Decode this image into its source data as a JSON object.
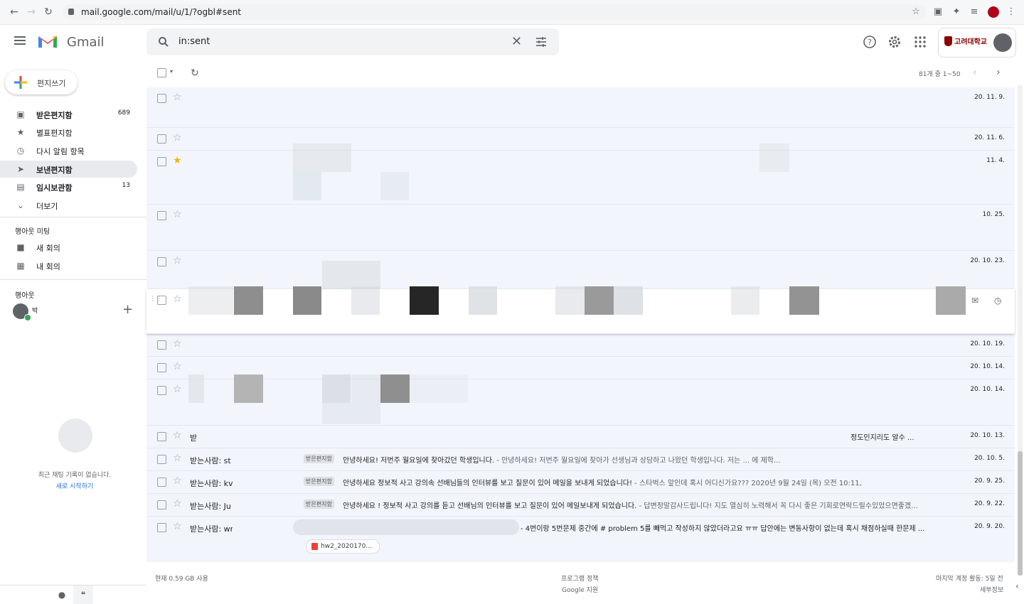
{
  "browser": {
    "url": "mail.google.com/mail/u/1/?ogbl#sent"
  },
  "header": {
    "app_name": "Gmail",
    "search_value": "in:sent",
    "org_logo_text": "고려대학교"
  },
  "sidebar": {
    "compose_label": "편지쓰기",
    "items": [
      {
        "label": "받은편지함",
        "count": "689",
        "icon": "inbox-icon"
      },
      {
        "label": "별표편지함",
        "count": "",
        "icon": "star-icon"
      },
      {
        "label": "다시 알림 항목",
        "count": "",
        "icon": "clock-icon"
      },
      {
        "label": "보낸편지함",
        "count": "",
        "icon": "send-icon"
      },
      {
        "label": "임시보관함",
        "count": "13",
        "icon": "draft-icon"
      },
      {
        "label": "더보기",
        "count": "",
        "icon": "chevron-down-icon"
      }
    ],
    "meet_section": "행아웃 미팅",
    "meet_items": [
      {
        "label": "새 회의",
        "icon": "video-icon"
      },
      {
        "label": "내 회의",
        "icon": "calendar-icon"
      }
    ],
    "hangouts_section": "행아웃",
    "hangouts_user": "박",
    "chat_empty": "최근 채팅 기록이 없습니다.",
    "chat_start": "새로 시작하기"
  },
  "toolbar": {
    "pager_text": "81개 중 1~50"
  },
  "emails": [
    {
      "sender": "",
      "label": "",
      "subject": "",
      "snippet": "",
      "date": "20. 11. 9.",
      "starred": false
    },
    {
      "sender": "",
      "label": "",
      "subject": "",
      "snippet": "",
      "date": "20. 11. 6.",
      "starred": false
    },
    {
      "sender": "",
      "label": "",
      "subject": "",
      "snippet": "",
      "date": "11. 4.",
      "starred": true
    },
    {
      "sender": "",
      "label": "",
      "subject": "",
      "snippet": "",
      "date": "10. 25.",
      "starred": false
    },
    {
      "sender": "",
      "label": "",
      "subject": "",
      "snippet": "",
      "date": "20. 10. 23.",
      "starred": false
    },
    {
      "sender": "",
      "label": "",
      "subject": "",
      "snippet": "",
      "date": "",
      "starred": false
    },
    {
      "sender": "",
      "label": "",
      "subject": "",
      "snippet": "",
      "date": "20. 10. 19.",
      "starred": false
    },
    {
      "sender": "",
      "label": "",
      "subject": "",
      "snippet": "",
      "date": "20. 10. 14.",
      "starred": false
    },
    {
      "sender": "",
      "label": "",
      "subject": "",
      "snippet": "",
      "date": "20. 10. 14.",
      "starred": false
    },
    {
      "sender": "받",
      "label": "",
      "subject": "",
      "snippet": "정도인지리도 알수 ...",
      "date": "20. 10. 13.",
      "starred": false
    },
    {
      "sender": "받는사람: st",
      "label": "받은편지함",
      "subject": "안녕하세요! 저번주 월요일에 찾아갔던 학생입니다.",
      "snippet": " - 안녕하세요! 저번주 월요일에 찾아가 선생님과 상담하고 나왔던 학생입니다. 저는 ... 에 제학...",
      "date": "20. 10. 5.",
      "starred": false
    },
    {
      "sender": "받는사람: kv",
      "label": "받은편지함",
      "subject": "안녕하세요 정보적 사고 강의속 선배님들의 인터뷰를 보고 질문이 있어 메일을 보내게 되었습니다!",
      "snippet": " - 스타벅스 앞인데 혹시 어디신가요??? 2020년 9월 24일 (목) 오전 10:11,",
      "date": "20. 9. 25.",
      "starred": false
    },
    {
      "sender": "받는사람: Ju",
      "label": "받은편지함",
      "subject": "안녕하세요 ! 정보적 사고 강의를 듣고 선배님의 인터뷰를 보고 질문이 있어 메일보내게 되었습니다.",
      "snippet": " - 답변정말감사드립니다! 지도 열심히 노력해서 꼭 다시 좋은 기회로연락드릴수있었으면좋겠...",
      "date": "20. 9. 22.",
      "starred": false
    },
    {
      "sender": "받는사람: wr",
      "label": "",
      "subject": "",
      "snippet": " - 4번이랑 5번문제 중간에 # problem 5를 빼먹고 작성하지 않았더라고요 ㅠㅠ 답안에는 변동사항이 없는데 혹시 채점하실때 한문제 ...",
      "date": "20. 9. 20.",
      "starred": false,
      "attachment": "hw2_2020170..."
    }
  ],
  "footer": {
    "storage": "현재 0.59 GB 사용",
    "policy": "프로그램 정책",
    "support": "Google 지원",
    "last_activity": "마지막 계정 활동: 5일 전",
    "details": "세부정보"
  }
}
